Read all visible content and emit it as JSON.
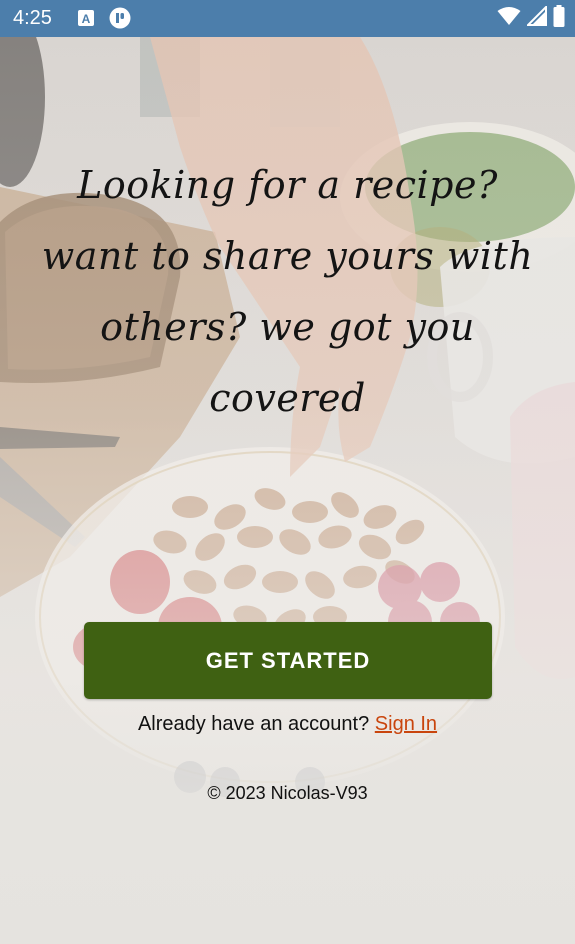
{
  "status_bar": {
    "time": "4:25",
    "background_color": "#4c7eab",
    "left_icons": [
      "font-a-icon",
      "app-notification-icon"
    ],
    "right_icons": [
      "wifi-icon",
      "cell-signal-icon",
      "battery-icon"
    ]
  },
  "hero": {
    "tagline": "Looking for a recipe? want to share yours with others? we got you covered",
    "background_image": "food-table-photo"
  },
  "cta": {
    "label": "GET STARTED",
    "color": "#3f6112"
  },
  "signin": {
    "prompt": "Already have an account?",
    "link_label": "Sign In",
    "link_color": "#c9450d"
  },
  "footer": {
    "copyright": "© 2023 Nicolas-V93"
  }
}
